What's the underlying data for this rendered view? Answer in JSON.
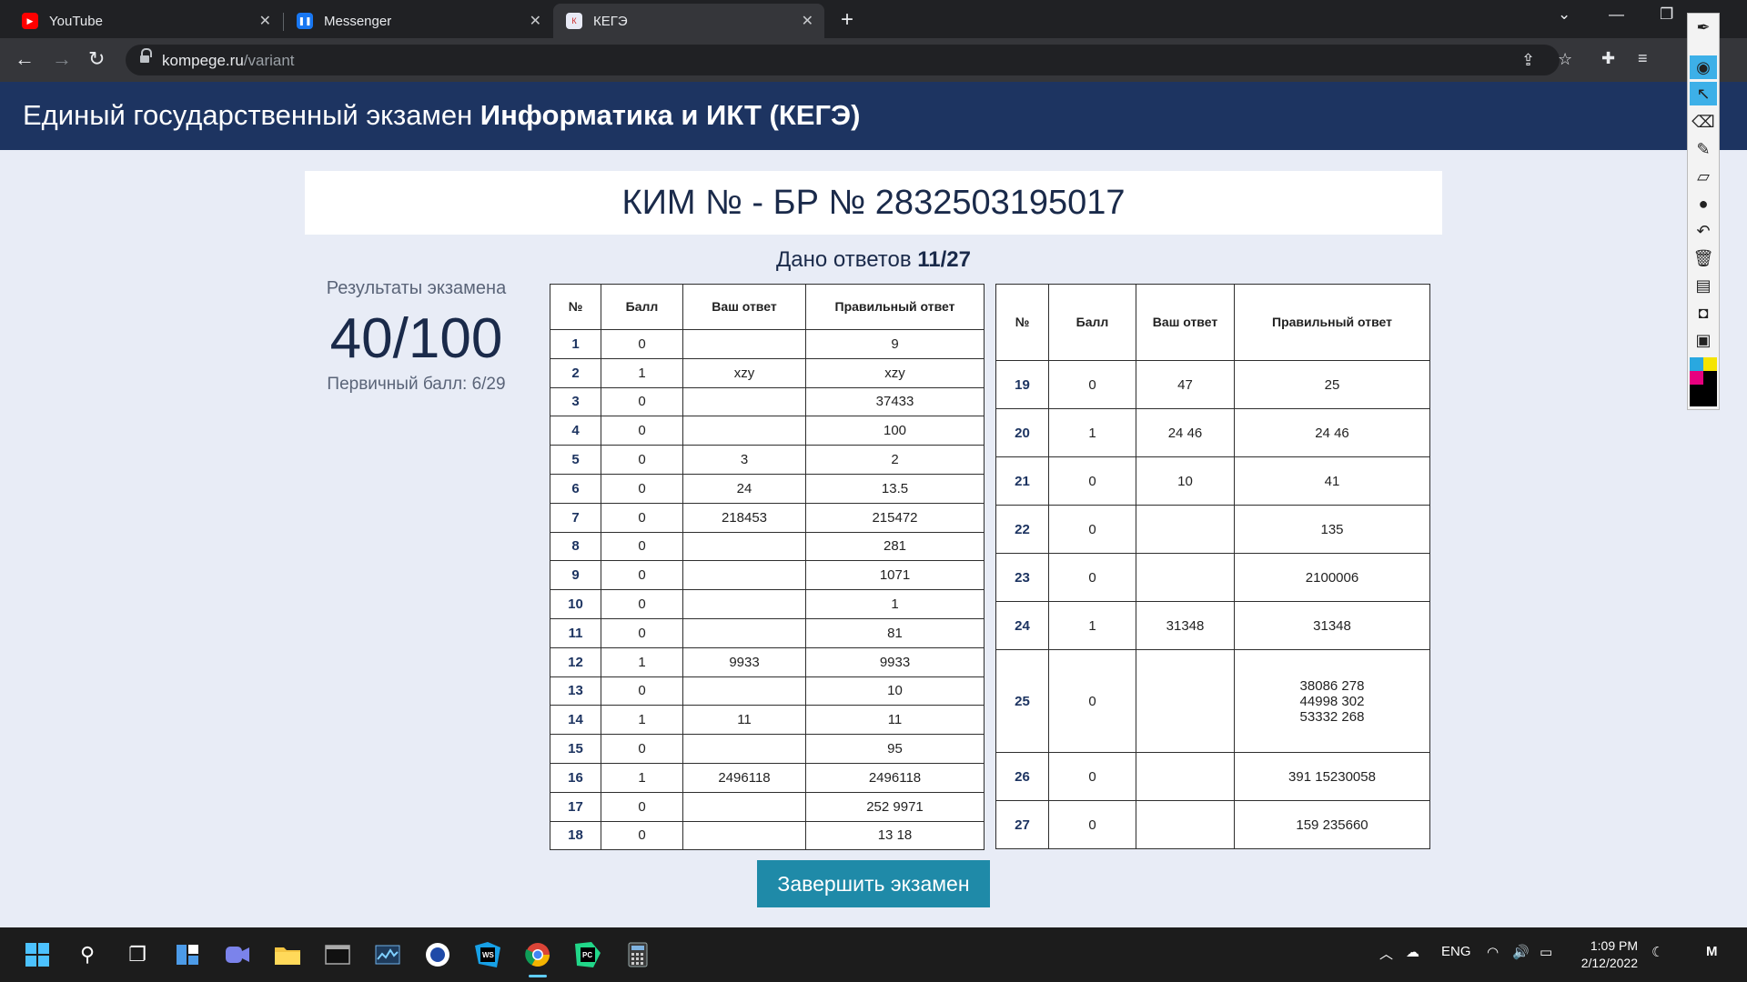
{
  "browser": {
    "tabs": [
      {
        "title": "YouTube",
        "icon": "youtube-icon",
        "color": "#ff0000"
      },
      {
        "title": "Messenger",
        "icon": "messenger-icon",
        "color": "#1877f2"
      },
      {
        "title": "КЕГЭ",
        "icon": "kege-icon",
        "color": "#cc2a2a"
      }
    ],
    "url_domain": "kompege.ru",
    "url_path": "/variant"
  },
  "site": {
    "title_regular": "Единый государственный экзамен ",
    "title_bold": "Информатика и ИКТ (КЕГЭ)"
  },
  "variant": {
    "title": "КИМ № - БР № 2832503195017",
    "answered_label": "Дано ответов ",
    "answered_value": "11/27"
  },
  "results": {
    "label": "Результаты экзамена",
    "score": "40/100",
    "primary": "Первичный балл: 6/29"
  },
  "table_headers": {
    "num": "№",
    "score": "Балл",
    "yours": "Ваш ответ",
    "correct": "Правильный ответ"
  },
  "answers_left": [
    {
      "n": "1",
      "s": "0",
      "y": "",
      "c": "9"
    },
    {
      "n": "2",
      "s": "1",
      "y": "xzy",
      "c": "xzy"
    },
    {
      "n": "3",
      "s": "0",
      "y": "",
      "c": "37433"
    },
    {
      "n": "4",
      "s": "0",
      "y": "",
      "c": "100"
    },
    {
      "n": "5",
      "s": "0",
      "y": "3",
      "c": "2"
    },
    {
      "n": "6",
      "s": "0",
      "y": "24",
      "c": "13.5"
    },
    {
      "n": "7",
      "s": "0",
      "y": "218453",
      "c": "215472"
    },
    {
      "n": "8",
      "s": "0",
      "y": "",
      "c": "281"
    },
    {
      "n": "9",
      "s": "0",
      "y": "",
      "c": "1071"
    },
    {
      "n": "10",
      "s": "0",
      "y": "",
      "c": "1"
    },
    {
      "n": "11",
      "s": "0",
      "y": "",
      "c": "81"
    },
    {
      "n": "12",
      "s": "1",
      "y": "9933",
      "c": "9933"
    },
    {
      "n": "13",
      "s": "0",
      "y": "",
      "c": "10"
    },
    {
      "n": "14",
      "s": "1",
      "y": "11",
      "c": "11"
    },
    {
      "n": "15",
      "s": "0",
      "y": "",
      "c": "95"
    },
    {
      "n": "16",
      "s": "1",
      "y": "2496118",
      "c": "2496118"
    },
    {
      "n": "17",
      "s": "0",
      "y": "",
      "c": "252 9971"
    },
    {
      "n": "18",
      "s": "0",
      "y": "",
      "c": "13 18"
    }
  ],
  "answers_right": [
    {
      "n": "19",
      "s": "0",
      "y": "47",
      "c": "25"
    },
    {
      "n": "20",
      "s": "1",
      "y": "24 46",
      "c": "24 46"
    },
    {
      "n": "21",
      "s": "0",
      "y": "10",
      "c": "41"
    },
    {
      "n": "22",
      "s": "0",
      "y": "",
      "c": "135"
    },
    {
      "n": "23",
      "s": "0",
      "y": "",
      "c": "2100006"
    },
    {
      "n": "24",
      "s": "1",
      "y": "31348",
      "c": "31348"
    },
    {
      "n": "25",
      "s": "0",
      "y": "",
      "c": [
        "38086 278",
        "44998 302",
        "53332 268"
      ]
    },
    {
      "n": "26",
      "s": "0",
      "y": "",
      "c": "391 15230058"
    },
    {
      "n": "27",
      "s": "0",
      "y": "",
      "c": "159 235660"
    }
  ],
  "finish_button": "Завершить экзамен",
  "taskbar": {
    "lang": "ENG",
    "time": "1:09 PM",
    "date": "2/12/2022"
  }
}
